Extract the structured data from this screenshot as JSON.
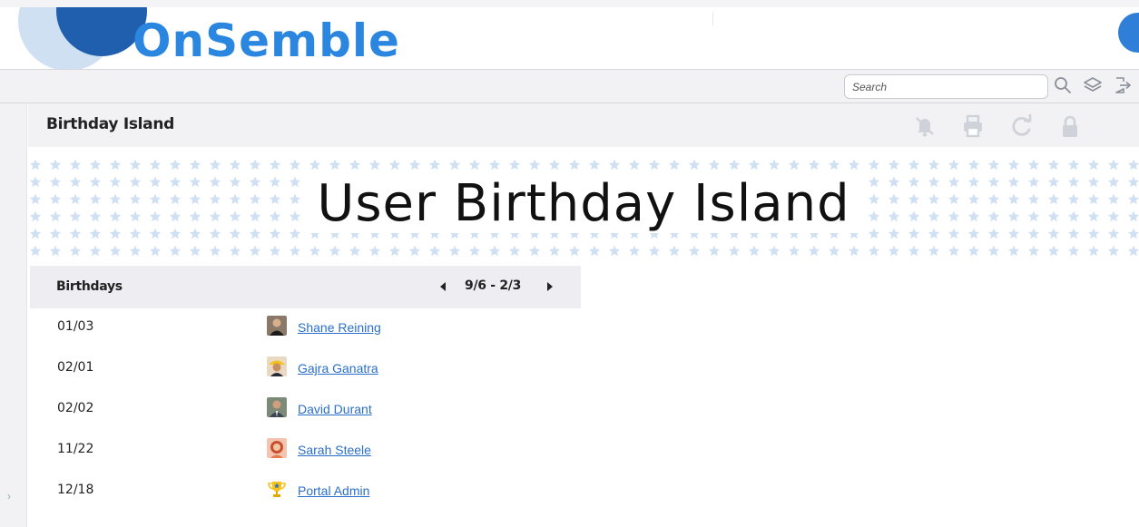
{
  "brand": {
    "name": "OnSemble"
  },
  "search": {
    "placeholder": "Search",
    "value": ""
  },
  "toolbar": {
    "icons": [
      "search-icon",
      "layers-icon",
      "logout-icon"
    ]
  },
  "page": {
    "title": "Birthday Island",
    "tools": [
      "notifications-off-icon",
      "print-icon",
      "refresh-icon",
      "lock-icon"
    ]
  },
  "banner": {
    "title": "User Birthday Island"
  },
  "birthdays": {
    "heading": "Birthdays",
    "range": "9/6 - 2/3",
    "rows": [
      {
        "date": "01/03",
        "name": "Shane Reining",
        "avatar": "photo-dark-shirt"
      },
      {
        "date": "02/01",
        "name": "Gajra Ganatra",
        "avatar": "photo-yellow-hat"
      },
      {
        "date": "02/02",
        "name": "David Durant",
        "avatar": "photo-suit"
      },
      {
        "date": "11/22",
        "name": "Sarah Steele",
        "avatar": "photo-red-hair"
      },
      {
        "date": "12/18",
        "name": "Portal Admin",
        "avatar": "trophy-icon"
      }
    ]
  },
  "colors": {
    "brand_blue": "#2b86e0",
    "link_blue": "#2a6fc9",
    "panel_gray": "#f2f2f4",
    "star_blue": "#cfe0f3"
  }
}
